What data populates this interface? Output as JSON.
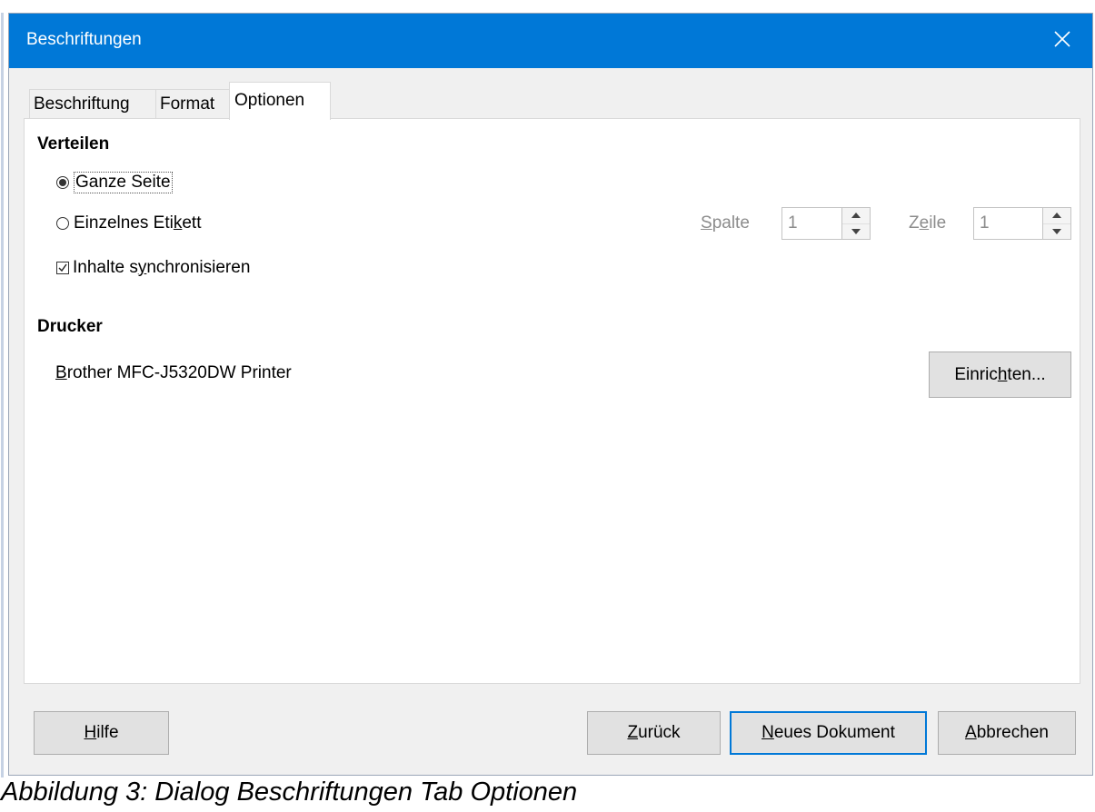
{
  "dialog": {
    "title": "Beschriftungen",
    "accent_color": "#0078d7",
    "close_icon": "close-icon"
  },
  "tabs": [
    {
      "label": "Beschriftung",
      "active": false
    },
    {
      "label": "Format",
      "active": false
    },
    {
      "label": "Optionen",
      "active": true
    }
  ],
  "distribute": {
    "heading": "Verteilen",
    "option_whole_page": {
      "label": "Ganze Seite",
      "selected": true
    },
    "option_single_label": {
      "pre": "Einzelnes Eti",
      "accel": "k",
      "post": "ett",
      "selected": false
    },
    "sync": {
      "pre": "Inhalte s",
      "accel": "y",
      "post": "nchronisieren",
      "checked": true
    },
    "column": {
      "accel": "S",
      "rest": "palte",
      "value": "1"
    },
    "row": {
      "pre": "Z",
      "accel": "e",
      "post": "ile",
      "value": "1"
    }
  },
  "printer": {
    "heading": "Drucker",
    "name_accel": "B",
    "name_rest": "rother MFC-J5320DW Printer",
    "setup_pre": "Einric",
    "setup_accel": "h",
    "setup_post": "ten..."
  },
  "footer": {
    "help": {
      "accel": "H",
      "rest": "ilfe"
    },
    "back": {
      "accel": "Z",
      "rest": "urück"
    },
    "new_doc": {
      "accel": "N",
      "rest": "eues Dokument"
    },
    "cancel": {
      "accel": "A",
      "rest": "bbrechen"
    }
  },
  "caption": "Abbildung 3: Dialog Beschriftungen Tab Optionen"
}
